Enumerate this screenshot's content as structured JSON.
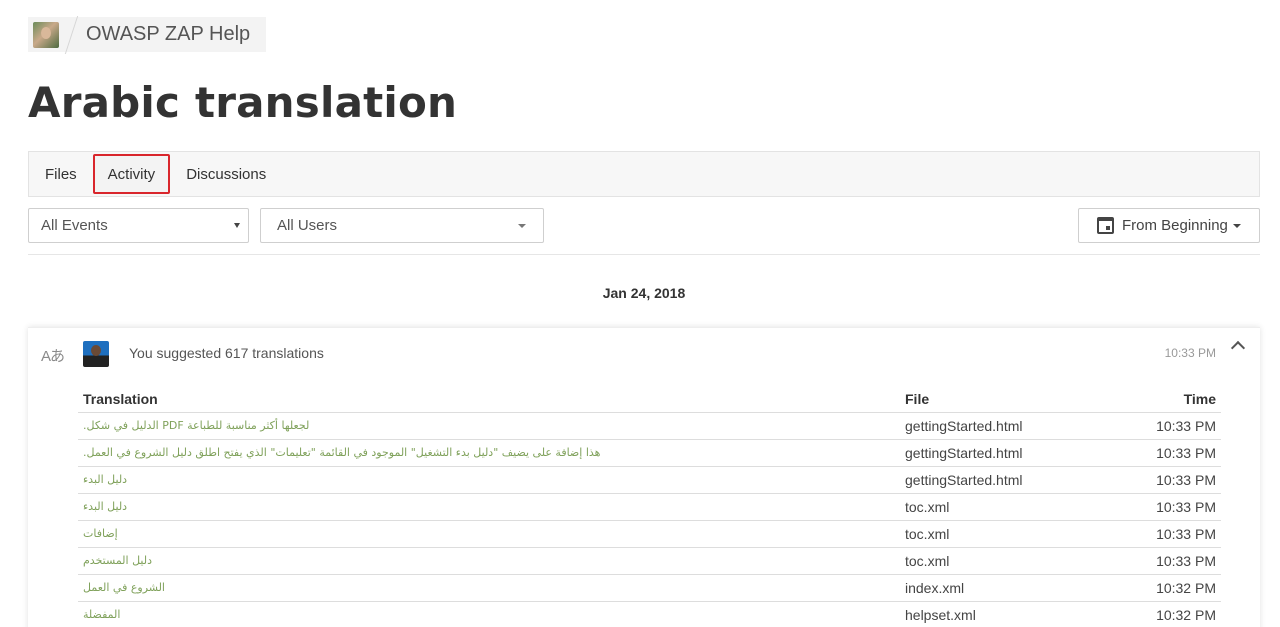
{
  "breadcrumb": {
    "project_name": "OWASP ZAP Help",
    "avatar_icon": "project-avatar"
  },
  "page": {
    "title": "Arabic translation"
  },
  "tabs": [
    {
      "label": "Files",
      "active": false
    },
    {
      "label": "Activity",
      "active": true
    },
    {
      "label": "Discussions",
      "active": false
    }
  ],
  "filters": {
    "events": {
      "selected": "All Events"
    },
    "users": {
      "selected": "All Users"
    },
    "date": {
      "selected": "From Beginning",
      "icon": "calendar-icon"
    }
  },
  "activity": {
    "date_heading": "Jan 24, 2018",
    "entry": {
      "icon": "translate-icon",
      "icon_glyph": "Aあ",
      "text": "You suggested 617 translations",
      "time": "10:33 PM"
    },
    "table": {
      "headers": {
        "translation": "Translation",
        "file": "File",
        "time": "Time"
      },
      "rows": [
        {
          "translation": "لجعلها أكثر مناسبة للطباعة PDF الدليل في شكل.",
          "file": "gettingStarted.html",
          "time": "10:33 PM"
        },
        {
          "translation": "هذا إضافة على يضيف \"دليل بدء التشغيل\" الموجود في القائمة \"تعليمات\" الذي يفتح اطلق دليل الشروع في العمل.",
          "file": "gettingStarted.html",
          "time": "10:33 PM"
        },
        {
          "translation": "دليل البدء",
          "file": "gettingStarted.html",
          "time": "10:33 PM"
        },
        {
          "translation": "دليل البدء",
          "file": "toc.xml",
          "time": "10:33 PM"
        },
        {
          "translation": "إضافات",
          "file": "toc.xml",
          "time": "10:33 PM"
        },
        {
          "translation": "دليل المستخدم",
          "file": "toc.xml",
          "time": "10:33 PM"
        },
        {
          "translation": "الشروع في العمل",
          "file": "index.xml",
          "time": "10:32 PM"
        },
        {
          "translation": "المفضلة",
          "file": "helpset.xml",
          "time": "10:32 PM"
        }
      ]
    }
  }
}
